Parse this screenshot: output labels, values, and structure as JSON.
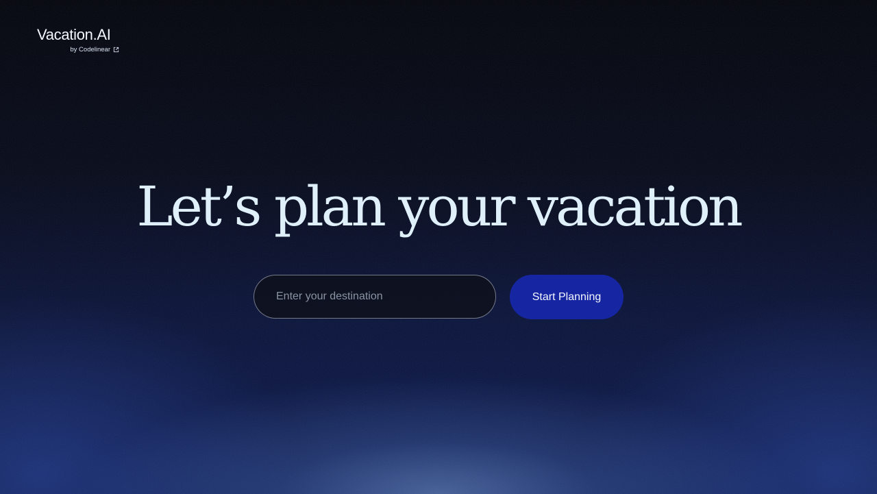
{
  "brand": {
    "name": "Vacation.AI",
    "by_label": "by Codelinear",
    "by_icon": "external-link-icon"
  },
  "hero": {
    "headline": "Let’s plan your vacation"
  },
  "search": {
    "placeholder": "Enter your destination",
    "value": "",
    "button_label": "Start Planning"
  },
  "colors": {
    "button_bg": "#1626a3",
    "headline": "#dff0fb",
    "background_top": "#03050d",
    "background_bottom": "#0d1a4a"
  }
}
